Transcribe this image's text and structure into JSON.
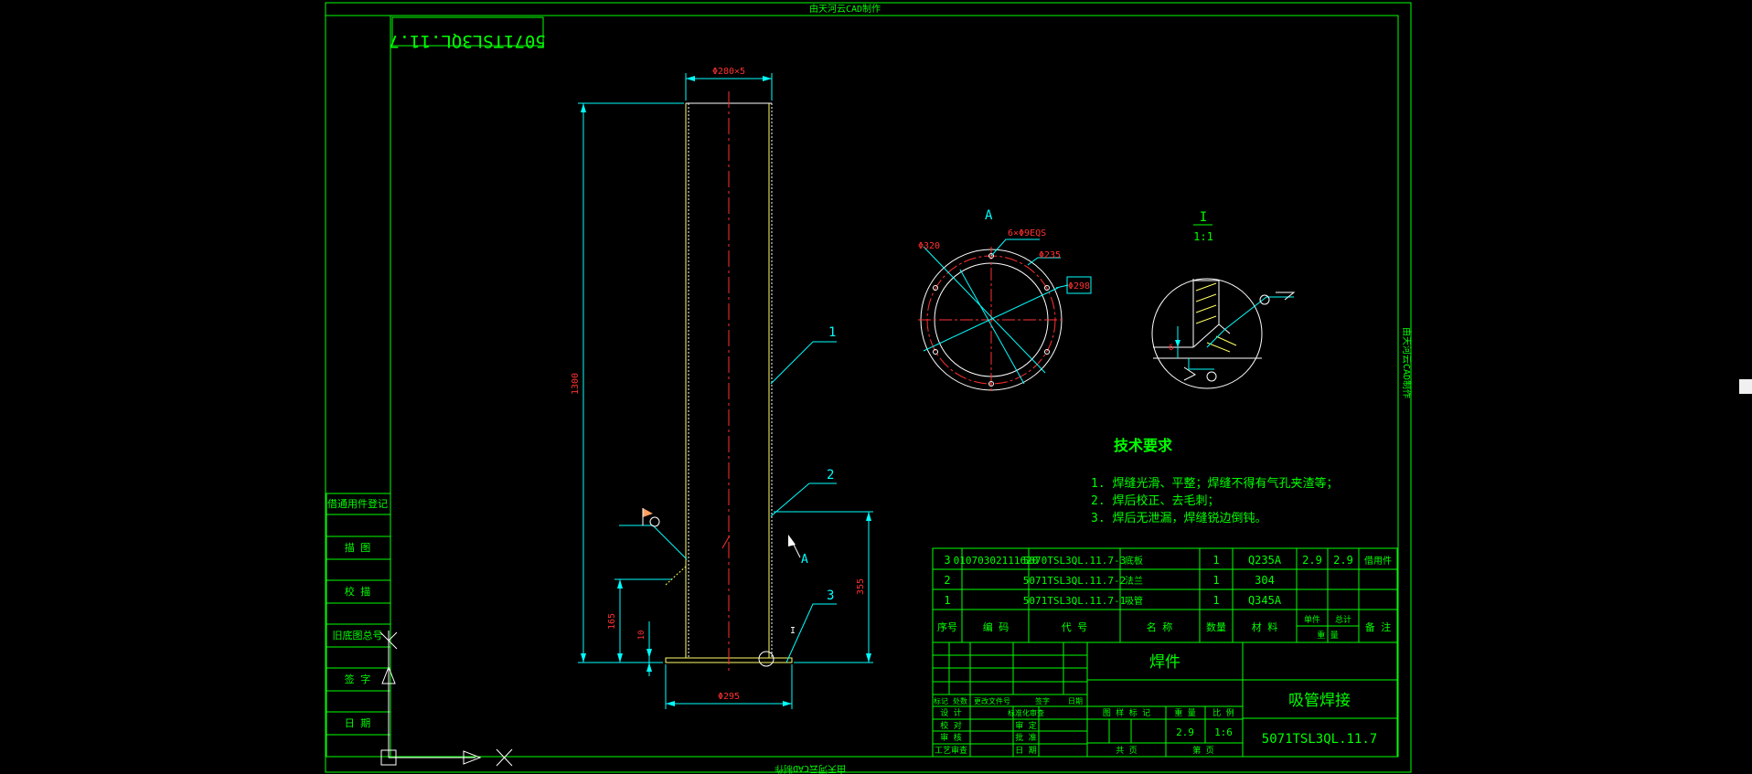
{
  "watermark": "由天河云CAD制作",
  "corner_code": "5071TSL3QL.11.7",
  "side_box": {
    "rows": [
      "借通用件登记",
      "描 图",
      "校 描",
      "旧底图总号",
      "签 字",
      "日 期"
    ]
  },
  "main_view": {
    "dim_top": "Φ280×5",
    "dim_height": "1300",
    "dim_right": "355",
    "dim_left": "165",
    "dim_small": "10",
    "dim_bottom": "Φ295",
    "leader_1": "1",
    "leader_2": "2",
    "leader_3": "3",
    "detail_mark": "I",
    "view_arrow": "A"
  },
  "view_a": {
    "label": "A",
    "dim_outer": "Φ320",
    "dim_holes": "6×Φ9EQS",
    "dim_pcd": "Φ235",
    "dim_inner": "Φ298"
  },
  "detail_view": {
    "label": "I",
    "scale": "1:1",
    "dim_weld": "6"
  },
  "tech_req": {
    "title": "技术要求",
    "items": [
      "1. 焊缝光滑、平整；焊缝不得有气孔夹渣等；",
      "2. 焊后校正、去毛刺；",
      "3. 焊后无泄漏，焊缝锐边倒钝。"
    ]
  },
  "bom": {
    "rows": [
      {
        "no": "3",
        "code": "01070302111620",
        "drawing": "5070TSL3QL.11.7-3",
        "name": "底板",
        "qty": "1",
        "material": "Q235A",
        "unit_w": "2.9",
        "total_w": "2.9",
        "remark": "借用件"
      },
      {
        "no": "2",
        "code": "",
        "drawing": "5071TSL3QL.11.7-2",
        "name": "法兰",
        "qty": "1",
        "material": "304",
        "unit_w": "",
        "total_w": "",
        "remark": ""
      },
      {
        "no": "1",
        "code": "",
        "drawing": "5071TSL3QL.11.7-1",
        "name": "吸管",
        "qty": "1",
        "material": "Q345A",
        "unit_w": "",
        "total_w": "",
        "remark": ""
      }
    ],
    "headers": {
      "no": "序号",
      "code": "编 码",
      "drawing": "代 号",
      "name": "名 称",
      "qty": "数量",
      "material": "材 料",
      "unit": "单件",
      "total": "总计",
      "weight": "重 量",
      "remark": "备 注"
    }
  },
  "title_block": {
    "part_type": "焊件",
    "part_name": "吸管焊接",
    "drawing_no": "5071TSL3QL.11.7",
    "weight": "2.9",
    "scale": "1:6",
    "labels": {
      "mark": "标记",
      "count": "处数",
      "change_doc": "更改文件号",
      "sign": "签字",
      "date": "日期",
      "design": "设 计",
      "check": "校 对",
      "review": "审 核",
      "process": "工艺审查",
      "std_review": "标准化审查",
      "audit": "审 定",
      "approve": "批 准",
      "date2": "日 期",
      "stage_mark": "图 样 标 记",
      "weight_l": "重 量",
      "scale_l": "比 例",
      "sheets": "共 页",
      "sheet": "第 页"
    }
  },
  "colors": {
    "frame": "#00ff00",
    "dimension": "#00ffff",
    "centerline": "#ff3030",
    "part": "#ffffff",
    "weld": "#ffff66",
    "symbol": "#ffa060"
  }
}
